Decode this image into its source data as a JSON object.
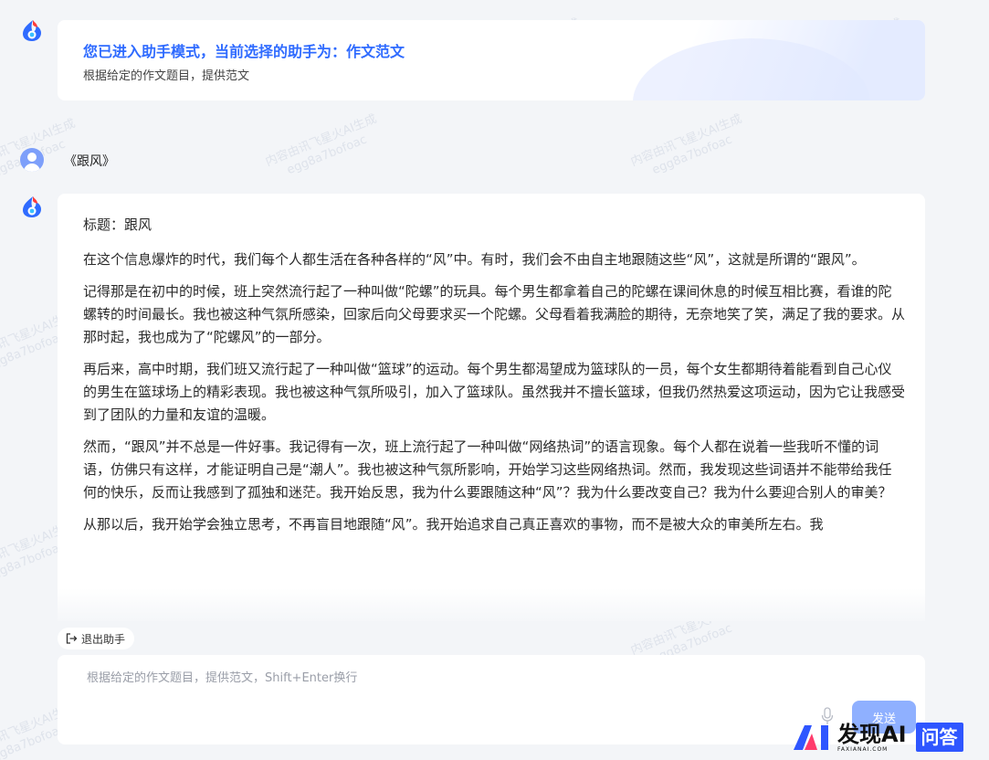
{
  "watermark": {
    "line1": "内容由讯飞星火AI生成",
    "line2": "egg8a7bofoac"
  },
  "assistant": {
    "title": "您已进入助手模式，当前选择的助手为：作文范文",
    "subtitle": "根据给定的作文题目，提供范文"
  },
  "user": {
    "message": "《跟风》"
  },
  "answer": {
    "paragraphs": [
      "标题：跟风",
      "在这个信息爆炸的时代，我们每个人都生活在各种各样的“风”中。有时，我们会不由自主地跟随这些“风”，这就是所谓的“跟风”。",
      "记得那是在初中的时候，班上突然流行起了一种叫做“陀螺”的玩具。每个男生都拿着自己的陀螺在课间休息的时候互相比赛，看谁的陀螺转的时间最长。我也被这种气氛所感染，回家后向父母要求买一个陀螺。父母看着我满脸的期待，无奈地笑了笑，满足了我的要求。从那时起，我也成为了“陀螺风”的一部分。",
      "再后来，高中时期，我们班又流行起了一种叫做“篮球”的运动。每个男生都渴望成为篮球队的一员，每个女生都期待着能看到自己心仪的男生在篮球场上的精彩表现。我也被这种气氛所吸引，加入了篮球队。虽然我并不擅长篮球，但我仍然热爱这项运动，因为它让我感受到了团队的力量和友谊的温暖。",
      "然而，“跟风”并不总是一件好事。我记得有一次，班上流行起了一种叫做“网络热词”的语言现象。每个人都在说着一些我听不懂的词语，仿佛只有这样，才能证明自己是“潮人”。我也被这种气氛所影响，开始学习这些网络热词。然而，我发现这些词语并不能带给我任何的快乐，反而让我感到了孤独和迷茫。我开始反思，我为什么要跟随这种“风”？我为什么要改变自己？我为什么要迎合别人的审美？",
      "从那以后，我开始学会独立思考，不再盲目地跟随“风”。我开始追求自己真正喜欢的事物，而不是被大众的审美所左右。我"
    ]
  },
  "exit_button": {
    "label": "退出助手"
  },
  "input": {
    "placeholder": "根据给定的作文题目，提供范文，Shift+Enter换行",
    "send_label": "发送"
  },
  "brand": {
    "name": "发现AI",
    "domain": "FAXIANAI.COM",
    "badge": "问答"
  },
  "colors": {
    "accent": "#2f6bff",
    "send": "#8fb0ff",
    "page_bg": "#f3f5f8",
    "badge": "#2f56ff"
  }
}
